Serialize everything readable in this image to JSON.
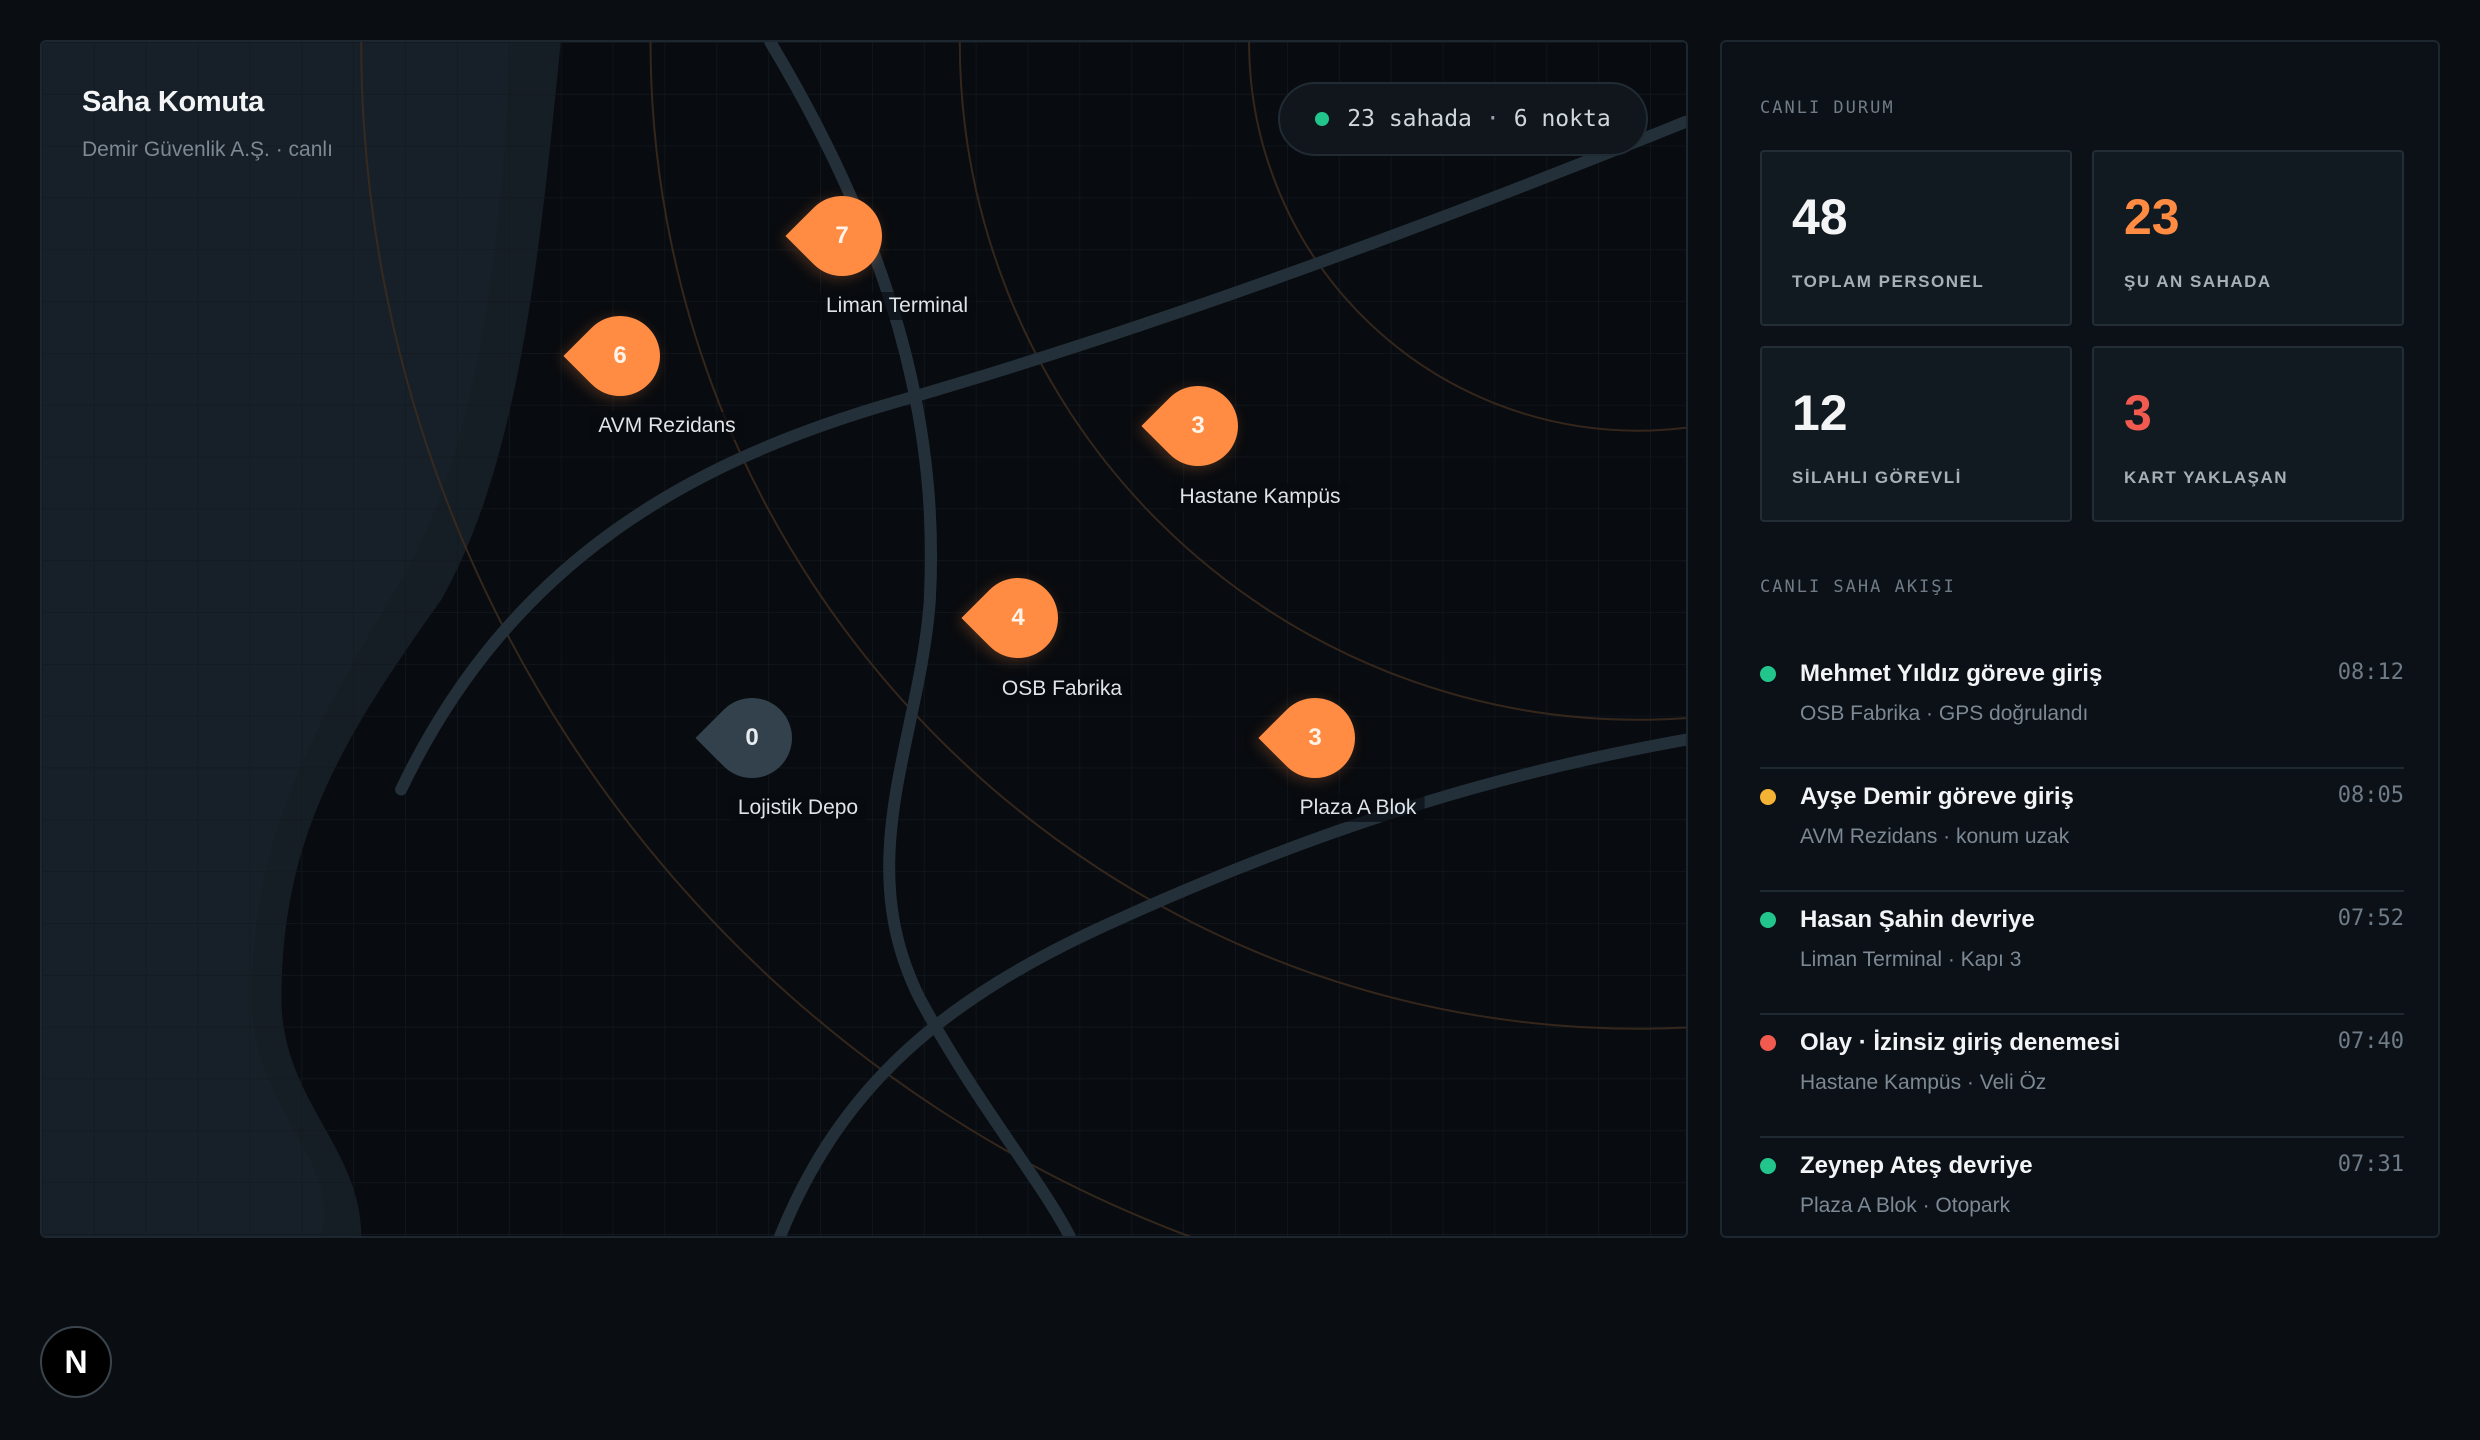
{
  "map": {
    "title": "Saha Komuta",
    "subtitle": "Demir Güvenlik A.Ş. · canlı",
    "status": {
      "on_site": "23 sahada",
      "separator": "·",
      "points": "6 nokta",
      "dot_color": "#22c58b"
    },
    "sites": [
      {
        "count": "7",
        "label": "Liman Terminal",
        "state": "active"
      },
      {
        "count": "6",
        "label": "AVM Rezidans",
        "state": "active"
      },
      {
        "count": "3",
        "label": "Hastane Kampüs",
        "state": "active"
      },
      {
        "count": "4",
        "label": "OSB Fabrika",
        "state": "active"
      },
      {
        "count": "0",
        "label": "Lojistik Depo",
        "state": "idle"
      },
      {
        "count": "3",
        "label": "Plaza A Blok",
        "state": "active"
      }
    ]
  },
  "side": {
    "live_status_heading": "CANLI DURUM",
    "stats": [
      {
        "value": "48",
        "caption": "TOPLAM PERSONEL"
      },
      {
        "value": "23",
        "caption": "ŞU AN SAHADA"
      },
      {
        "value": "12",
        "caption": "SİLAHLI GÖREVLİ"
      },
      {
        "value": "3",
        "caption": "KART YAKLAŞAN"
      }
    ],
    "feed_heading": "CANLI SAHA AKIŞI",
    "feed": [
      {
        "title": "Mehmet Yıldız göreve giriş",
        "detail": "OSB Fabrika · GPS doğrulandı",
        "time": "08:12",
        "status_color": "#22c58b"
      },
      {
        "title": "Ayşe Demir göreve giriş",
        "detail": "AVM Rezidans · konum uzak",
        "time": "08:05",
        "status_color": "#f5b335"
      },
      {
        "title": "Hasan Şahin devriye",
        "detail": "Liman Terminal · Kapı 3",
        "time": "07:52",
        "status_color": "#22c58b"
      },
      {
        "title": "Olay · İzinsiz giriş denemesi",
        "detail": "Hastane Kampüs · Veli Öz",
        "time": "07:40",
        "status_color": "#f05a4f"
      },
      {
        "title": "Zeynep Ateş devriye",
        "detail": "Plaza A Blok · Otopark",
        "time": "07:31",
        "status_color": "#22c58b"
      }
    ]
  },
  "badge": {
    "letter": "N"
  },
  "colors": {
    "accent": "#ff8c42",
    "alert": "#f05a4f",
    "ok": "#22c58b",
    "warn": "#f5b335",
    "idle_pin": "#33414c"
  }
}
